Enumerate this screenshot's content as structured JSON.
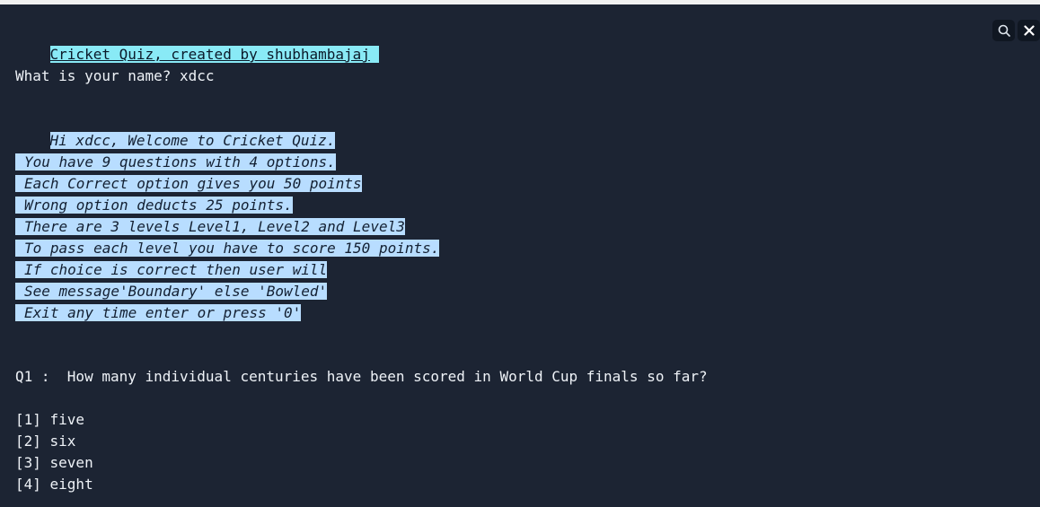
{
  "terminal": {
    "title": "Cricket Quiz, created by shubhambajaj",
    "name_prompt": "What is your name? xdcc",
    "welcome": "Hi xdcc, Welcome to Cricket Quiz.",
    "rules": [
      "You have 9 questions with 4 options.",
      "Each Correct option gives you 50 points",
      "Wrong option deducts 25 points.",
      "There are 3 levels Level1, Level2 and Level3",
      "To pass each level you have to score 150 points.",
      "If choice is correct then user will",
      "See message'Boundary' else 'Bowled'",
      "Exit any time enter or press '0'"
    ],
    "question": "Q1 :  How many individual centuries have been scored in World Cup finals so far?",
    "options": [
      "[1] five",
      "[2] six",
      "[3] seven",
      "[4] eight"
    ]
  },
  "controls": {
    "search_icon": "search-icon",
    "close_icon": "close-icon"
  }
}
